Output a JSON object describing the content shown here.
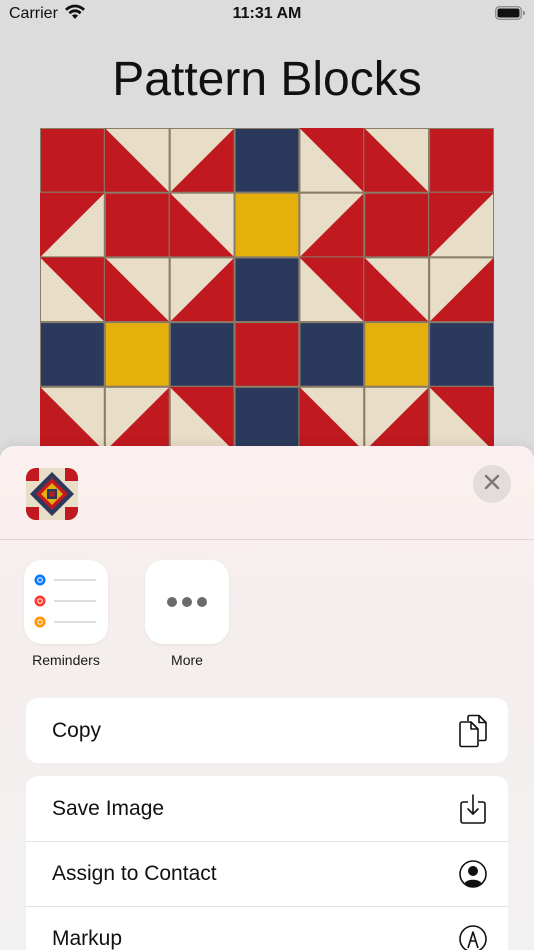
{
  "status_bar": {
    "carrier": "Carrier",
    "time": "11:31 AM",
    "wifi_icon": "wifi-icon",
    "battery_icon": "battery-icon"
  },
  "page": {
    "title": "Pattern Blocks",
    "image": "quilt-pattern-image"
  },
  "colors": {
    "red": "#c0191f",
    "cream": "#e8ddc6",
    "navy": "#2b3a5c",
    "gold": "#e6b00c",
    "accent_blue": "#0a7aff"
  },
  "share_sheet": {
    "close_icon": "close-icon",
    "apps": [
      {
        "label": "Reminders",
        "icon": "reminders-icon"
      },
      {
        "label": "More",
        "icon": "more-icon"
      }
    ],
    "actions": [
      {
        "label": "Copy",
        "icon": "copy-icon"
      },
      {
        "label": "Save Image",
        "icon": "save-image-icon"
      },
      {
        "label": "Assign to Contact",
        "icon": "contact-icon"
      },
      {
        "label": "Markup",
        "icon": "markup-icon"
      }
    ]
  }
}
